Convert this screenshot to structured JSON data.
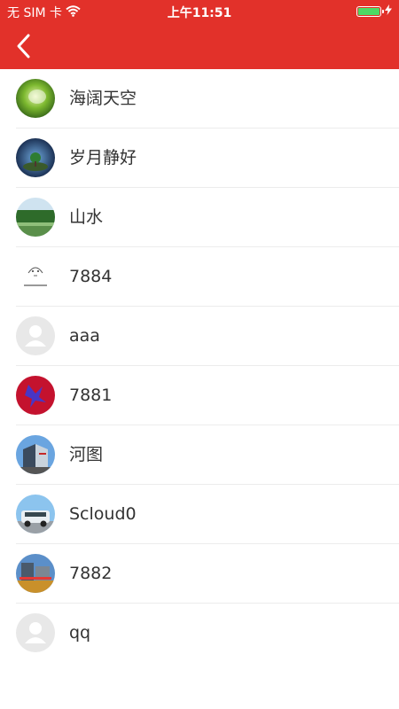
{
  "status_bar": {
    "carrier": "无 SIM 卡",
    "time": "上午11:51",
    "battery_level": 1.0,
    "icons": [
      "wifi-icon",
      "battery-icon",
      "charging-icon"
    ]
  },
  "nav": {
    "back_icon": "chevron-left-icon",
    "bar_color": "#e2312a"
  },
  "users": [
    {
      "name": "海阔天空",
      "avatar": "green-leaf-photo"
    },
    {
      "name": "岁月静好",
      "avatar": "planet-tree-photo"
    },
    {
      "name": "山水",
      "avatar": "lake-forest-photo"
    },
    {
      "name": "7884",
      "avatar": "sketch-face-image"
    },
    {
      "name": "aaa",
      "avatar": "default-avatar"
    },
    {
      "name": "7881",
      "avatar": "red-blue-art-photo"
    },
    {
      "name": "河图",
      "avatar": "building-photo"
    },
    {
      "name": "Scloud0",
      "avatar": "car-photo"
    },
    {
      "name": "7882",
      "avatar": "city-building-photo"
    },
    {
      "name": "qq",
      "avatar": "default-avatar"
    }
  ]
}
